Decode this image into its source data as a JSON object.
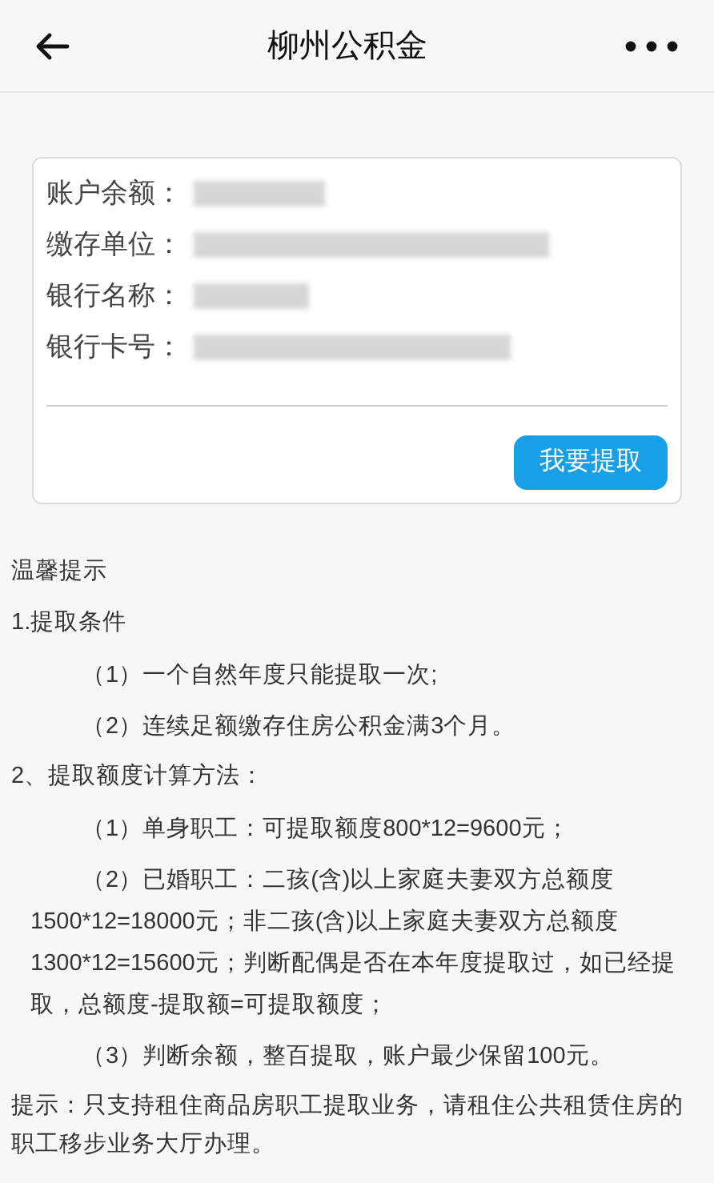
{
  "header": {
    "title": "柳州公积金"
  },
  "account": {
    "fields": [
      {
        "label": "账户余额："
      },
      {
        "label": "缴存单位："
      },
      {
        "label": "银行名称："
      },
      {
        "label": "银行卡号："
      }
    ],
    "button": "我要提取"
  },
  "notes": [
    {
      "kind": "plain",
      "text": "温馨提示"
    },
    {
      "kind": "plain",
      "text": "1.提取条件"
    },
    {
      "kind": "item",
      "text": "（1）一个自然年度只能提取一次;"
    },
    {
      "kind": "item",
      "text": "（2）连续足额缴存住房公积金满3个月。"
    },
    {
      "kind": "plain",
      "text": "2、提取额度计算方法："
    },
    {
      "kind": "item",
      "text": "（1）单身职工：可提取额度800*12=9600元；"
    },
    {
      "kind": "item",
      "text": "（2）已婚职工：二孩(含)以上家庭夫妻双方总额度1500*12=18000元；非二孩(含)以上家庭夫妻双方总额度1300*12=15600元；判断配偶是否在本年度提取过，如已经提取，总额度-提取额=可提取额度；"
    },
    {
      "kind": "item",
      "text": "（3）判断余额，整百提取，账户最少保留100元。"
    },
    {
      "kind": "plain",
      "text": "提示：只支持租住商品房职工提取业务，请租住公共租赁住房的职工移步业务大厅办理。"
    }
  ]
}
